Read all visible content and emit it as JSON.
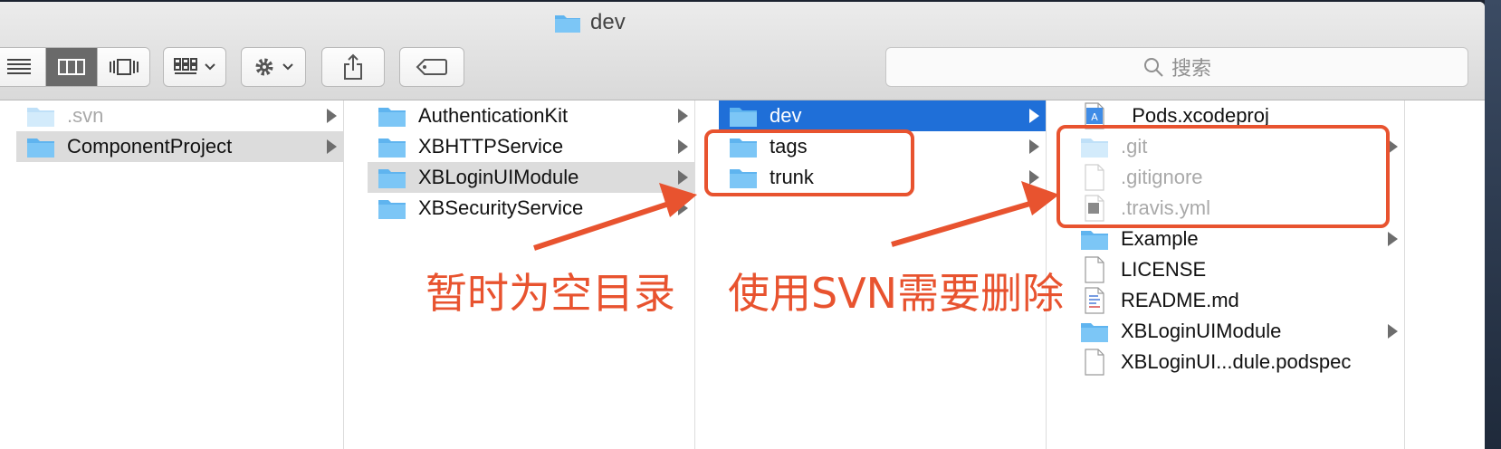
{
  "window": {
    "title": "dev"
  },
  "toolbar": {
    "view_buttons": [
      "list-view-icon",
      "column-view-icon",
      "coverflow-view-icon"
    ],
    "arrange_icon": "grid-arrange-icon",
    "action_icon": "gear-icon",
    "share_icon": "share-icon",
    "tag_icon": "tag-icon",
    "search_placeholder": "搜索"
  },
  "columns": [
    {
      "items": [
        {
          "name": ".svn",
          "type": "folder",
          "dim": true,
          "arrow": true
        },
        {
          "name": "ComponentProject",
          "type": "folder",
          "selected": "gray",
          "arrow": true
        }
      ]
    },
    {
      "items": [
        {
          "name": "AuthenticationKit",
          "type": "folder",
          "arrow": true
        },
        {
          "name": "XBHTTPService",
          "type": "folder",
          "arrow": true
        },
        {
          "name": "XBLoginUIModule",
          "type": "folder",
          "selected": "gray",
          "arrow": true
        },
        {
          "name": "XBSecurityService",
          "type": "folder",
          "arrow": true
        }
      ]
    },
    {
      "items": [
        {
          "name": "dev",
          "type": "folder",
          "selected": "blue",
          "arrow": true
        },
        {
          "name": "tags",
          "type": "folder",
          "arrow": true
        },
        {
          "name": "trunk",
          "type": "folder",
          "arrow": true
        }
      ]
    },
    {
      "items": [
        {
          "name": "_Pods.xcodeproj",
          "type": "xcodeproj"
        },
        {
          "name": ".git",
          "type": "folder",
          "dim": true,
          "arrow": true
        },
        {
          "name": ".gitignore",
          "type": "file",
          "dim": true
        },
        {
          "name": ".travis.yml",
          "type": "yml",
          "dim": true
        },
        {
          "name": "Example",
          "type": "folder",
          "arrow": true
        },
        {
          "name": "LICENSE",
          "type": "file"
        },
        {
          "name": "README.md",
          "type": "md"
        },
        {
          "name": "XBLoginUIModule",
          "type": "folder",
          "arrow": true
        },
        {
          "name": "XBLoginUI...dule.podspec",
          "type": "file"
        }
      ]
    }
  ],
  "annotations": {
    "empty_dirs": "暂时为空目录",
    "svn_delete": "使用SVN需要删除"
  },
  "colors": {
    "annotation": "#e8532f",
    "selection": "#1f6fd8",
    "folder": "#5fb4ef"
  }
}
